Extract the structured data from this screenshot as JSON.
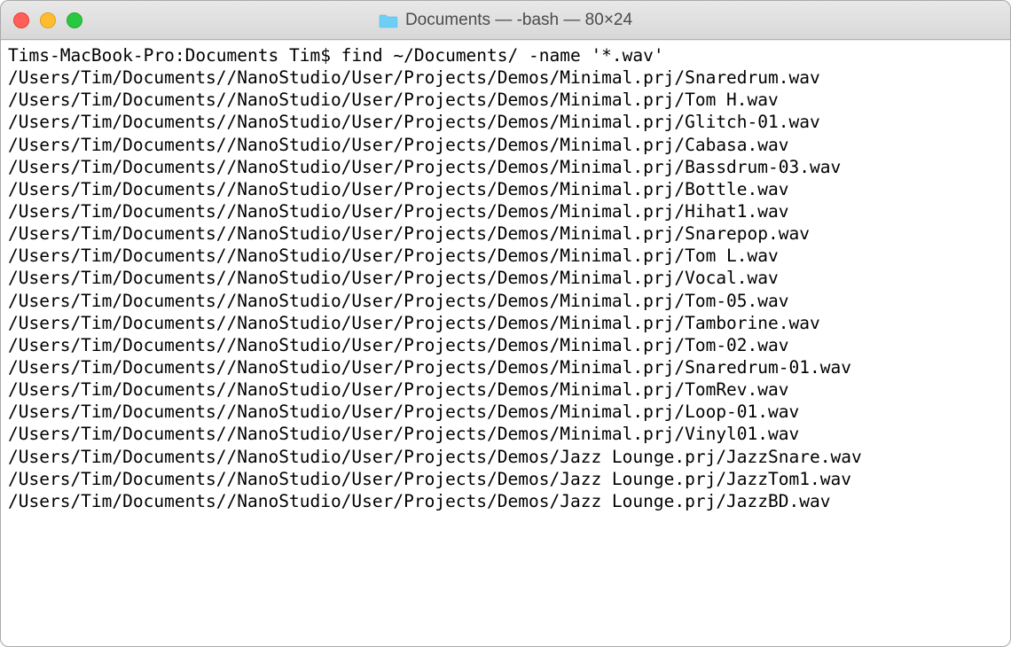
{
  "window": {
    "title": "Documents — -bash — 80×24"
  },
  "terminal": {
    "prompt": "Tims-MacBook-Pro:Documents Tim$ find ~/Documents/ -name '*.wav'",
    "lines": [
      "/Users/Tim/Documents//NanoStudio/User/Projects/Demos/Minimal.prj/Snaredrum.wav",
      "/Users/Tim/Documents//NanoStudio/User/Projects/Demos/Minimal.prj/Tom H.wav",
      "/Users/Tim/Documents//NanoStudio/User/Projects/Demos/Minimal.prj/Glitch-01.wav",
      "/Users/Tim/Documents//NanoStudio/User/Projects/Demos/Minimal.prj/Cabasa.wav",
      "/Users/Tim/Documents//NanoStudio/User/Projects/Demos/Minimal.prj/Bassdrum-03.wav",
      "/Users/Tim/Documents//NanoStudio/User/Projects/Demos/Minimal.prj/Bottle.wav",
      "/Users/Tim/Documents//NanoStudio/User/Projects/Demos/Minimal.prj/Hihat1.wav",
      "/Users/Tim/Documents//NanoStudio/User/Projects/Demos/Minimal.prj/Snarepop.wav",
      "/Users/Tim/Documents//NanoStudio/User/Projects/Demos/Minimal.prj/Tom L.wav",
      "/Users/Tim/Documents//NanoStudio/User/Projects/Demos/Minimal.prj/Vocal.wav",
      "/Users/Tim/Documents//NanoStudio/User/Projects/Demos/Minimal.prj/Tom-05.wav",
      "/Users/Tim/Documents//NanoStudio/User/Projects/Demos/Minimal.prj/Tamborine.wav",
      "/Users/Tim/Documents//NanoStudio/User/Projects/Demos/Minimal.prj/Tom-02.wav",
      "/Users/Tim/Documents//NanoStudio/User/Projects/Demos/Minimal.prj/Snaredrum-01.wav",
      "/Users/Tim/Documents//NanoStudio/User/Projects/Demos/Minimal.prj/TomRev.wav",
      "/Users/Tim/Documents//NanoStudio/User/Projects/Demos/Minimal.prj/Loop-01.wav",
      "/Users/Tim/Documents//NanoStudio/User/Projects/Demos/Minimal.prj/Vinyl01.wav",
      "/Users/Tim/Documents//NanoStudio/User/Projects/Demos/Jazz Lounge.prj/JazzSnare.wav",
      "/Users/Tim/Documents//NanoStudio/User/Projects/Demos/Jazz Lounge.prj/JazzTom1.wav",
      "/Users/Tim/Documents//NanoStudio/User/Projects/Demos/Jazz Lounge.prj/JazzBD.wav"
    ]
  }
}
